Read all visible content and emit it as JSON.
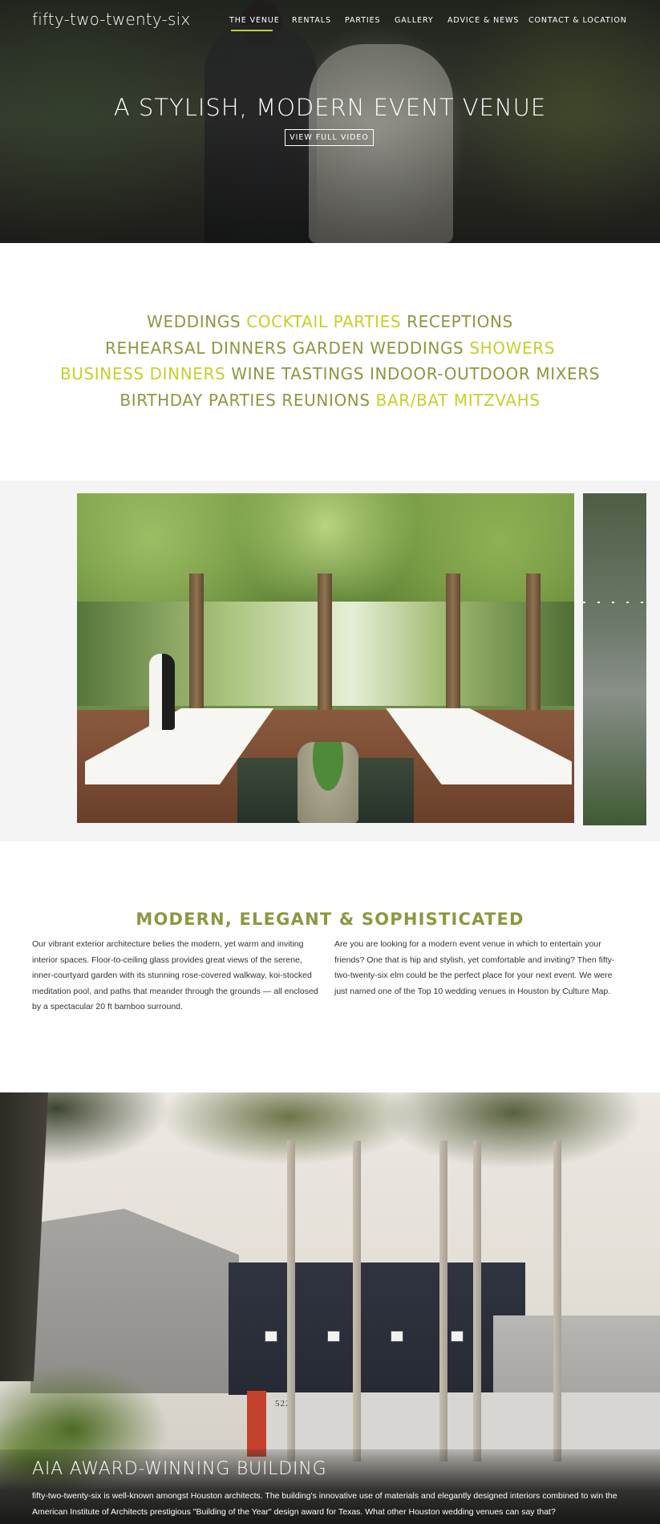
{
  "header": {
    "brand": "fifty-two-twenty-six",
    "nav": [
      {
        "label": "THE VENUE",
        "active": true
      },
      {
        "label": "RENTALS",
        "active": false
      },
      {
        "label": "PARTIES",
        "active": false
      },
      {
        "label": "GALLERY",
        "active": false
      },
      {
        "label": "ADVICE & NEWS",
        "active": false
      },
      {
        "label": "CONTACT & LOCATION",
        "active": false
      }
    ],
    "accent_color": "#c4d02c"
  },
  "hero": {
    "title": "A STYLISH, MODERN EVENT VENUE",
    "button_label": "VIEW FULL VIDEO"
  },
  "event_types": {
    "colors": {
      "olive": "#8e9740",
      "lime": "#c4d02c"
    },
    "lines": [
      [
        {
          "text": "WEDDINGS",
          "color": "olive"
        },
        {
          "text": "COCKTAIL PARTIES",
          "color": "lime"
        },
        {
          "text": "RECEPTIONS",
          "color": "olive"
        }
      ],
      [
        {
          "text": "REHEARSAL DINNERS",
          "color": "olive"
        },
        {
          "text": "GARDEN WEDDINGS",
          "color": "olive"
        },
        {
          "text": "SHOWERS",
          "color": "lime"
        }
      ],
      [
        {
          "text": "BUSINESS DINNERS",
          "color": "lime"
        },
        {
          "text": "WINE TASTINGS",
          "color": "olive"
        },
        {
          "text": "INDOOR-OUTDOOR MIXERS",
          "color": "olive"
        }
      ],
      [
        {
          "text": "BIRTHDAY PARTIES",
          "color": "olive"
        },
        {
          "text": "REUNIONS",
          "color": "olive"
        },
        {
          "text": "BAR/BAT MITZVAHS",
          "color": "lime"
        }
      ]
    ]
  },
  "about": {
    "title": "MODERN, ELEGANT & SOPHISTICATED",
    "left": "Our vibrant exterior architecture belies the modern, yet warm and inviting interior spaces. Floor-to-ceiling glass provides great views of the serene, inner-courtyard garden with its stunning rose-covered walkway, koi-stocked meditation pool, and paths that meander through the grounds — all enclosed by a spectacular 20 ft bamboo surround.",
    "right": "Are you are looking for a modern event venue in which to entertain your friends? One that is hip and stylish, yet comfortable and inviting? Then fifty-two-twenty-six elm could be the perfect place for your next event. We were just named one of the Top 10 wedding venues in Houston by Culture Map."
  },
  "building": {
    "number": "5226",
    "title": "AIA AWARD-WINNING BUILDING",
    "text": "fifty-two-twenty-six is well-known amongst Houston architects. The building's innovative use of materials and elegantly designed interiors combined to win the American Institute of Architects prestigious \"Building of the Year\" design award for Texas. What other Houston wedding venues can say that?"
  }
}
